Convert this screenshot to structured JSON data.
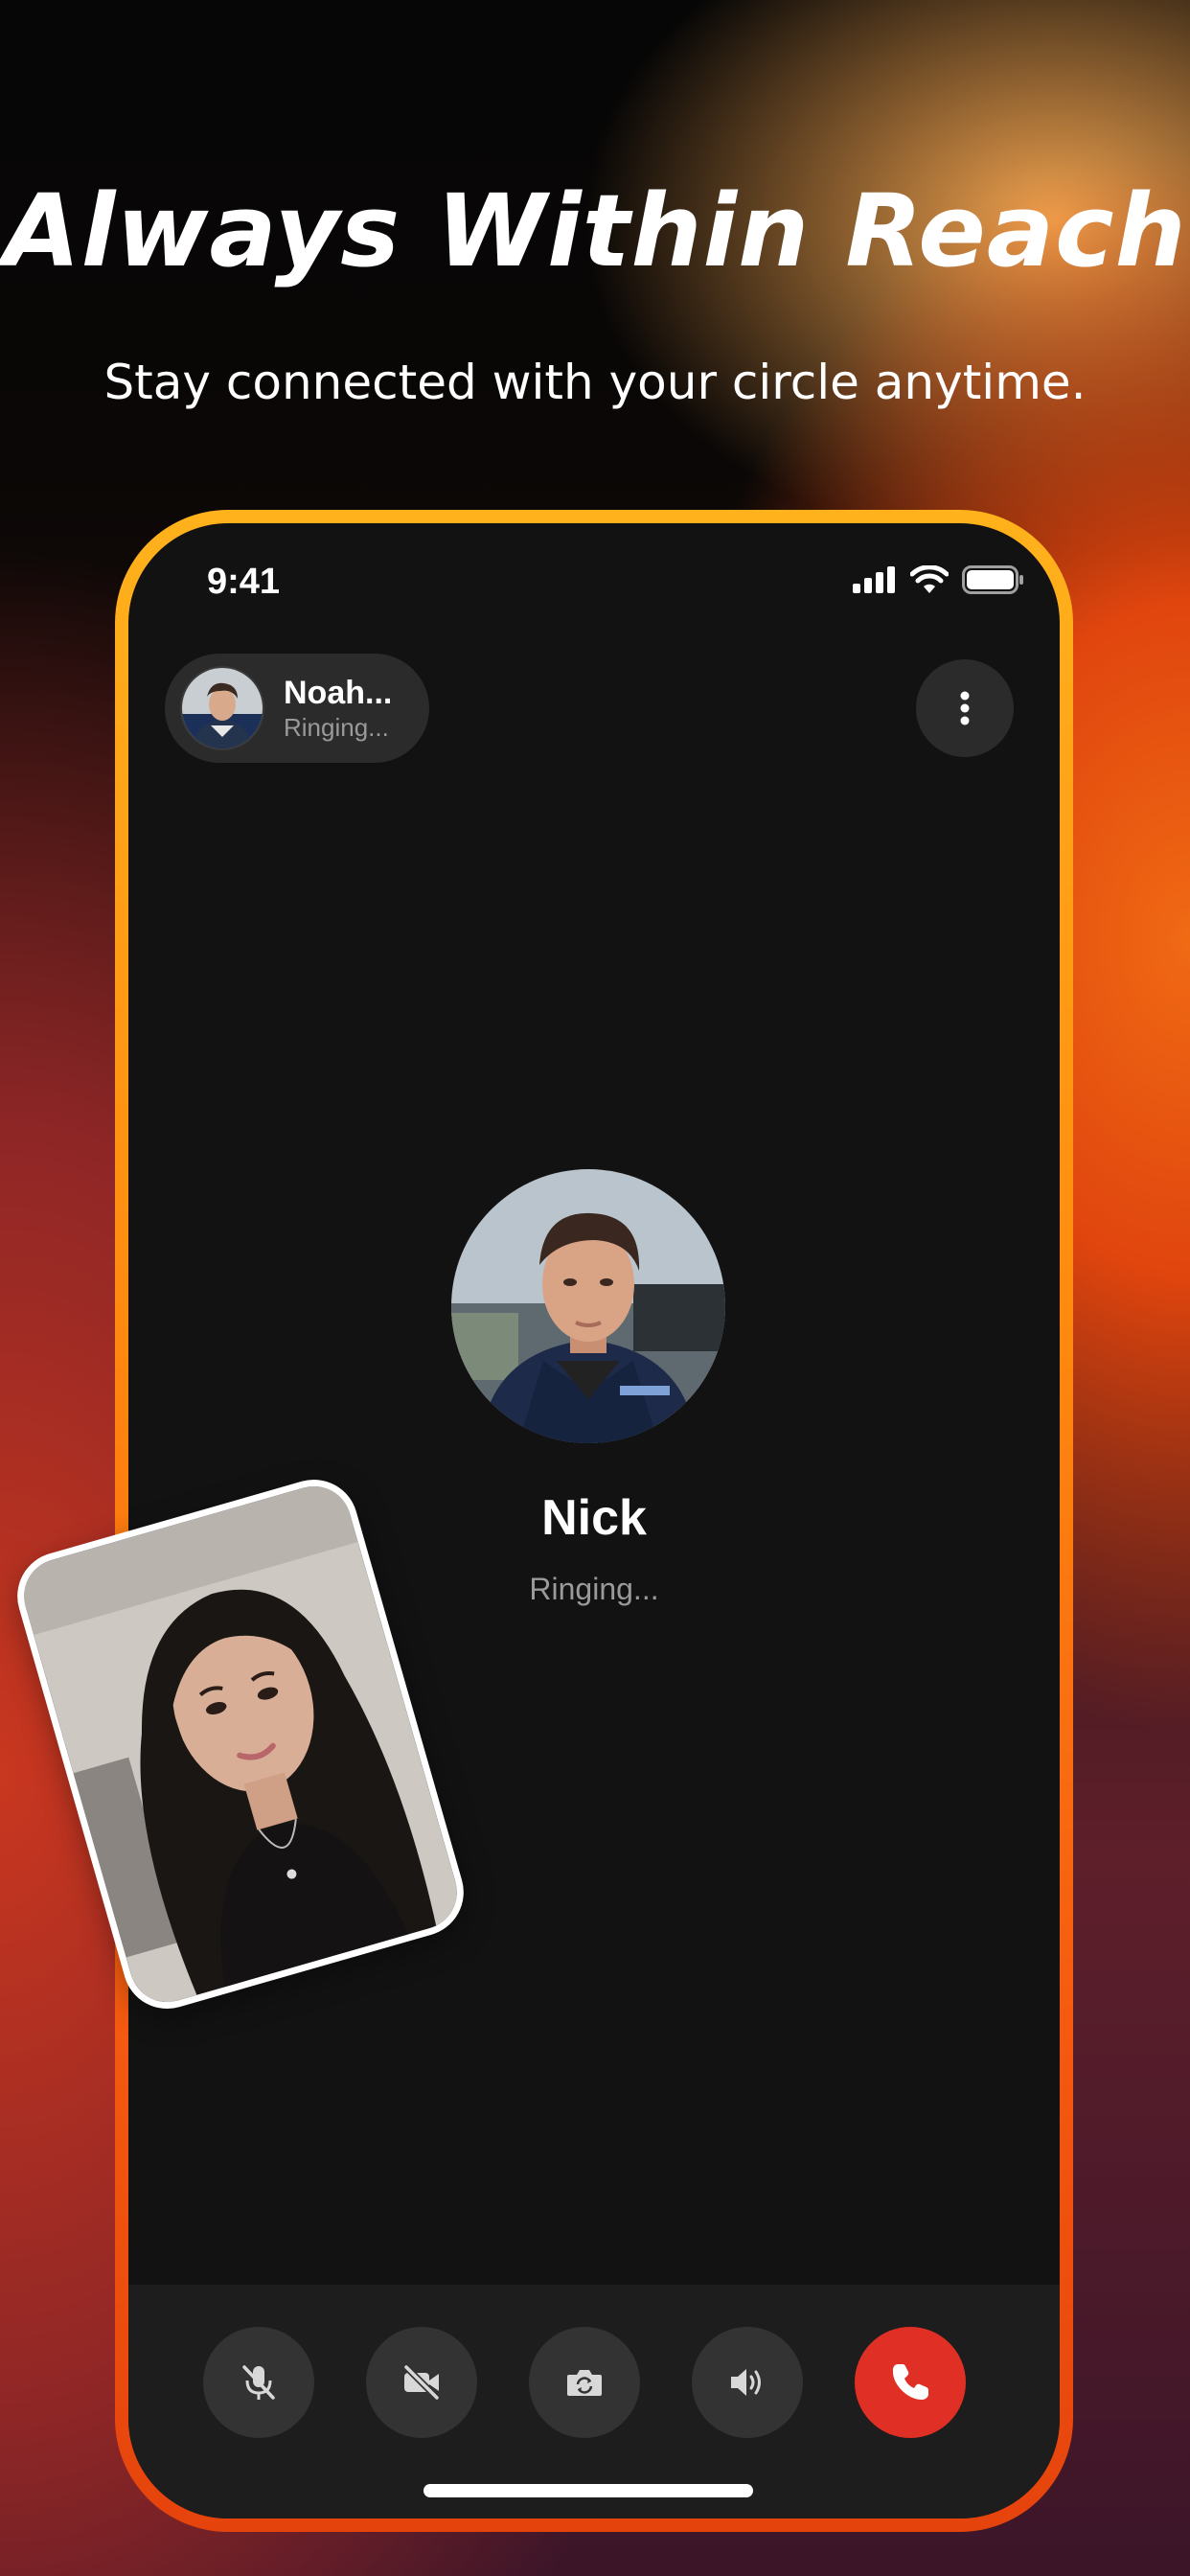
{
  "hero": {
    "headline": "Always Within Reach",
    "subline": "Stay connected with your circle anytime."
  },
  "status_bar": {
    "time": "9:41",
    "icons": [
      "cellular-signal-icon",
      "wifi-icon",
      "battery-icon"
    ]
  },
  "caller_pill": {
    "name": "Noah...",
    "status": "Ringing..."
  },
  "call": {
    "callee_name": "Nick",
    "status": "Ringing..."
  },
  "controls": [
    {
      "name": "mute-mic",
      "icon": "mic-off-icon"
    },
    {
      "name": "video-off",
      "icon": "video-off-icon"
    },
    {
      "name": "flip-camera",
      "icon": "camera-rotate-icon"
    },
    {
      "name": "speaker",
      "icon": "speaker-icon"
    },
    {
      "name": "end-call",
      "icon": "phone-icon"
    }
  ],
  "colors": {
    "frame_top": "#ffb21c",
    "frame_bottom": "#e5430c",
    "screen_bg": "#121212",
    "end_call": "#e02f24",
    "button_bg": "#333333"
  }
}
